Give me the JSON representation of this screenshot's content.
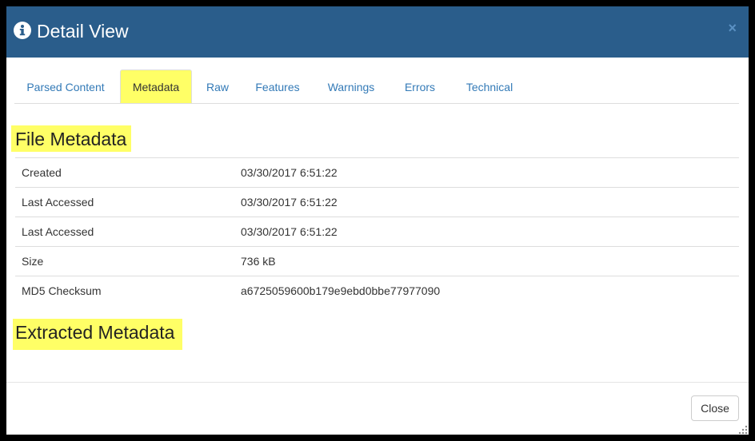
{
  "dialog": {
    "title": "Detail View",
    "title_icon": "info-circle-icon",
    "close_glyph": "×"
  },
  "tabs": [
    {
      "label": "Parsed Content",
      "active": false
    },
    {
      "label": "Metadata",
      "active": true
    },
    {
      "label": "Raw",
      "active": false
    },
    {
      "label": "Features",
      "active": false
    },
    {
      "label": "Warnings",
      "active": false
    },
    {
      "label": "Errors",
      "active": false
    },
    {
      "label": "Technical",
      "active": false
    }
  ],
  "file_metadata": {
    "title": "File Metadata",
    "rows": [
      {
        "key": "Created",
        "value": "03/30/2017 6:51:22"
      },
      {
        "key": "Last Accessed",
        "value": "03/30/2017 6:51:22"
      },
      {
        "key": "Last Accessed",
        "value": "03/30/2017 6:51:22"
      },
      {
        "key": "Size",
        "value": "736 kB"
      },
      {
        "key": "MD5 Checksum",
        "value": "a6725059600b179e9ebd0bbe77977090"
      }
    ]
  },
  "extracted_metadata": {
    "title": "Extracted Metadata"
  },
  "footer": {
    "close_label": "Close"
  },
  "colors": {
    "header_bg": "#2a5d8b",
    "highlight": "#ffff66",
    "link": "#337ab7"
  }
}
